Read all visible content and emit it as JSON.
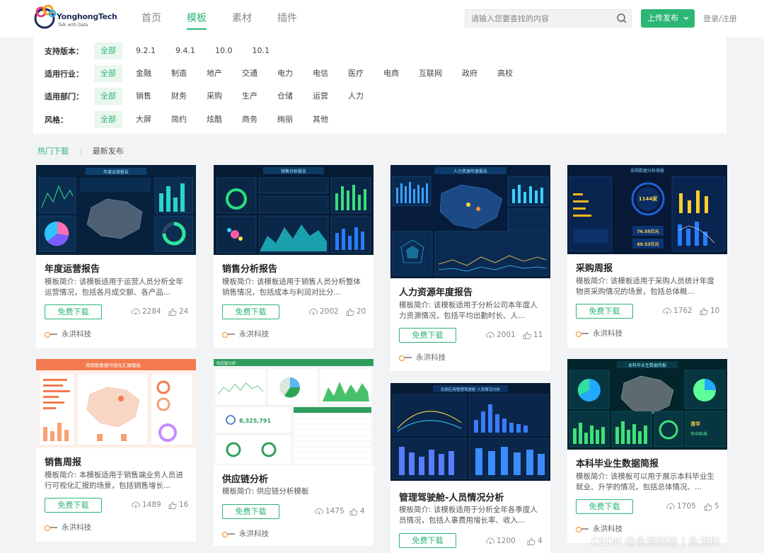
{
  "header": {
    "logo_name": "YonghongTech",
    "logo_tagline": "Talk with Data",
    "nav": [
      "首页",
      "模板",
      "素材",
      "插件"
    ],
    "nav_active": 1,
    "search_placeholder": "请输入您要查找的内容",
    "upload_label": "上传发布",
    "login_label": "登录/注册"
  },
  "filters": [
    {
      "label": "支持版本：",
      "options": [
        "全部",
        "9.2.1",
        "9.4.1",
        "10.0",
        "10.1"
      ],
      "selected": 0
    },
    {
      "label": "适用行业：",
      "options": [
        "全部",
        "金融",
        "制造",
        "地产",
        "交通",
        "电力",
        "电信",
        "医疗",
        "电商",
        "互联网",
        "政府",
        "高校"
      ],
      "selected": 0
    },
    {
      "label": "适用部门：",
      "options": [
        "全部",
        "销售",
        "财务",
        "采购",
        "生产",
        "仓储",
        "运营",
        "人力"
      ],
      "selected": 0
    },
    {
      "label": "风格：",
      "options": [
        "全部",
        "大屏",
        "简约",
        "炫酷",
        "商务",
        "绚丽",
        "其他"
      ],
      "selected": 0
    }
  ],
  "sort_tabs": [
    "热门下载",
    "最新发布"
  ],
  "sort_active": 0,
  "download_label": "免费下载",
  "cards": [
    {
      "title": "年度运营报告",
      "desc": "模板简介: 该模板适用于运营人员分析全年运营情况，包括各月成交额、各产品...",
      "downloads": "2284",
      "likes": "24",
      "author": "永洪科技",
      "thumb_title": "年度运营报告",
      "theme": "dark"
    },
    {
      "title": "销售分析报告",
      "desc": "模板简介: 该模板适用于销售人员分析整体销售情况，包括成本与利润对比分...",
      "downloads": "2002",
      "likes": "20",
      "author": "永洪科技",
      "thumb_title": "销售分析报告",
      "theme": "dark"
    },
    {
      "title": "人力资源年度报告",
      "desc": "模板简介: 该模板适用于分析公司本年度人力资源情况，包括平均出勤时长、人...",
      "downloads": "2001",
      "likes": "11",
      "author": "永洪科技",
      "thumb_title": "人力资源年度报告",
      "theme": "dark"
    },
    {
      "title": "采购周报",
      "desc": "模板简介: 该模板适用于采购人员统计年度物资采购情况的场景，包括总体概...",
      "downloads": "1762",
      "likes": "10",
      "author": "永洪科技",
      "thumb_title": "采购数据分析周报",
      "thumb_value_1": "1144家",
      "thumb_value_2": "76.55亿元",
      "thumb_value_3": "69.53亿元",
      "theme": "dark"
    },
    {
      "title": "销售周报",
      "desc": "模板简介: 本模板适用于销售端业务人员进行可视化汇报的场景，包括销售增长...",
      "downloads": "1489",
      "likes": "16",
      "author": "永洪科技",
      "thumb_title": "周销售数据可视化汇报模板",
      "theme": "light"
    },
    {
      "title": "供应链分析",
      "desc": "模板简介: 供应链分析模板",
      "downloads": "1475",
      "likes": "4",
      "author": "永洪科技",
      "thumb_title": "供应链分析",
      "thumb_value_1": "8,325,791",
      "theme": "white"
    },
    {
      "title": "管理驾驶舱-人员情况分析",
      "desc": "模板简介: 该模板适用于分析全年各季度人员情况，包括人事费用增长率、收入...",
      "downloads": "1200",
      "likes": "4",
      "author": "永洪科技",
      "thumb_title": "总部应用管理驾驶舱 人员情况分析",
      "theme": "dark"
    },
    {
      "title": "本科毕业生数据简报",
      "desc": "模板简介: 该模板可以用于展示本科毕业生就业、升学的情况，包括总体情况、...",
      "downloads": "1705",
      "likes": "5",
      "author": "永洪科技",
      "thumb_title": "本科毕业生数据简报",
      "thumb_value_1": "清华",
      "thumb_value_2": "华中科技",
      "theme": "dark"
    }
  ],
  "watermark": "CSDN @永洪科技 | 永洪BI",
  "colors": {
    "accent": "#2bb673",
    "dark_bg": "#0b1e3a",
    "panel": "#0e2a4d"
  },
  "icons": {
    "search": "search-icon",
    "download_count": "cloud-download-icon",
    "like": "thumbs-up-icon",
    "caret": "chevron-down-icon"
  }
}
